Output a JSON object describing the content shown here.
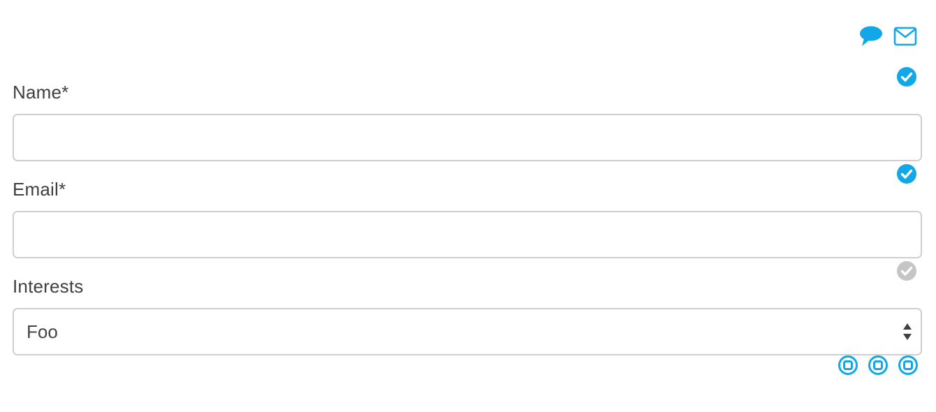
{
  "top_actions": {
    "chat": {
      "icon": "speech-bubble-icon"
    },
    "mail": {
      "icon": "envelope-icon"
    }
  },
  "form": {
    "fields": [
      {
        "label": "Name*",
        "value": "",
        "placeholder": "",
        "status": "valid"
      },
      {
        "label": "Email*",
        "value": "",
        "placeholder": "",
        "status": "valid"
      },
      {
        "label": "Interests",
        "selected": "Foo",
        "status": "neutral"
      }
    ]
  },
  "bottom_controls": [
    {
      "icon": "stop-circle-icon"
    },
    {
      "icon": "stop-circle-icon"
    },
    {
      "icon": "stop-circle-icon"
    }
  ],
  "colors": {
    "accent": "#12a8e8",
    "muted": "#c5c5c5",
    "text": "#3f3f3f",
    "border": "#cfcfcf"
  }
}
